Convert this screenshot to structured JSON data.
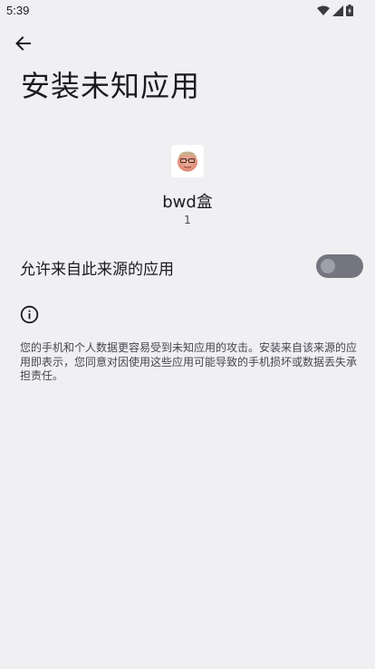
{
  "status_bar": {
    "time": "5:39",
    "icons": [
      "wifi-icon",
      "cell-signal-icon",
      "battery-charging-icon"
    ]
  },
  "header": {
    "back_icon": "arrow-back-icon",
    "title": "安装未知应用"
  },
  "app": {
    "icon": "app-face-icon",
    "name": "bwd盒",
    "version": "1"
  },
  "setting": {
    "label": "允许来自此来源的应用",
    "toggle_on": false
  },
  "info": {
    "icon": "info-icon",
    "text": "您的手机和个人数据更容易受到未知应用的攻击。安装来自该来源的应用即表示，您同意对因使用这些应用可能导致的手机损坏或数据丢失承担责任。"
  },
  "colors": {
    "background": "#f0f0f3",
    "toggle_track_off": "#74757f",
    "toggle_thumb_off": "#9fa0aa"
  }
}
